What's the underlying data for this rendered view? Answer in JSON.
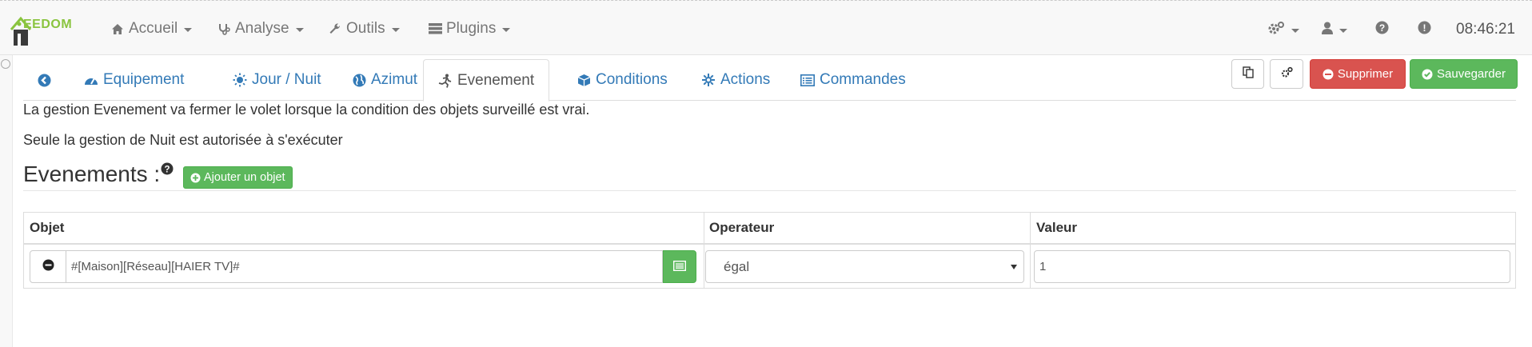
{
  "app": {
    "logo_text": "EEDOM"
  },
  "nav": {
    "items": [
      {
        "label": "Accueil",
        "icon": "home-icon"
      },
      {
        "label": "Analyse",
        "icon": "stethoscope-icon"
      },
      {
        "label": "Outils",
        "icon": "wrench-icon"
      },
      {
        "label": "Plugins",
        "icon": "tasks-icon"
      }
    ],
    "right_icons": [
      "cogs-icon",
      "user-icon",
      "question-circle-icon",
      "exclamation-circle-icon"
    ],
    "clock": "08:46:21"
  },
  "tabs": [
    {
      "label": "",
      "icon": "back-arrow-icon"
    },
    {
      "label": "Equipement",
      "icon": "tachometer-icon"
    },
    {
      "label": "Jour / Nuit",
      "icon": "sun-icon"
    },
    {
      "label": "Azimut",
      "icon": "globe-icon"
    },
    {
      "label": "Evenement",
      "icon": "running-icon",
      "active": true
    },
    {
      "label": "Conditions",
      "icon": "cube-icon"
    },
    {
      "label": "Actions",
      "icon": "asterisk-icon"
    },
    {
      "label": "Commandes",
      "icon": "list-alt-icon"
    }
  ],
  "actions": {
    "copy_icon": "copy-icon",
    "config_icon": "cogs-icon",
    "delete_label": "Supprimer",
    "save_label": "Sauvegarder"
  },
  "description": {
    "line1": "La gestion Evenement va fermer le volet lorsque la condition des objets surveillé est vrai.",
    "line2": "Seule la gestion de Nuit est autorisée à s'exécuter"
  },
  "section": {
    "title": "Evenements :",
    "add_label": "Ajouter un objet"
  },
  "table": {
    "headers": [
      "Objet",
      "Operateur",
      "Valeur"
    ],
    "rows": [
      {
        "objet": "#[Maison][Réseau][HAIER TV]#",
        "operateur": "égal",
        "valeur": "1"
      }
    ]
  },
  "colors": {
    "link": "#337ab7",
    "success": "#5cb85c",
    "danger": "#d9534f",
    "logo_green": "#8ac43f"
  }
}
